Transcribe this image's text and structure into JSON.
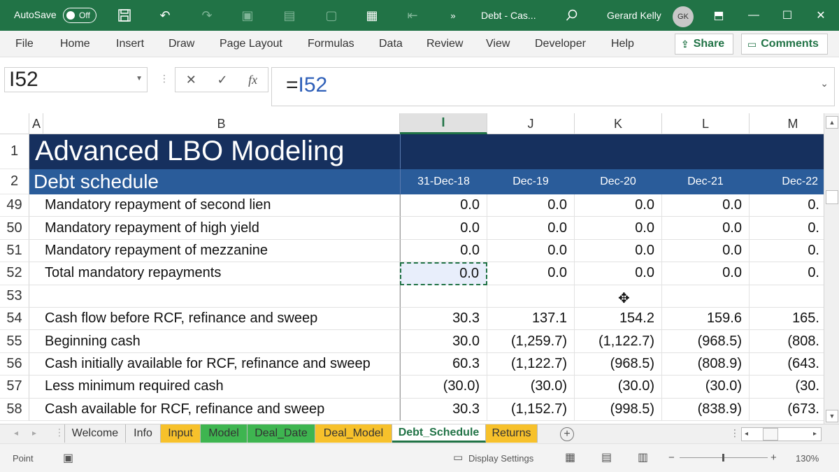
{
  "titlebar": {
    "autosave_label": "AutoSave",
    "autosave_state": "Off",
    "doc_title": "Debt - Cas...",
    "more": "»",
    "user_name": "Gerard Kelly",
    "user_initials": "GK"
  },
  "ribbon": {
    "tabs": [
      "File",
      "Home",
      "Insert",
      "Draw",
      "Page Layout",
      "Formulas",
      "Data",
      "Review",
      "View",
      "Developer",
      "Help"
    ],
    "share_label": "Share",
    "comments_label": "Comments"
  },
  "formula_bar": {
    "name_box": "I52",
    "formula_prefix": "=",
    "formula_ref": "I52",
    "fx": "fx"
  },
  "columns": {
    "A": "A",
    "B": "B",
    "I": "I",
    "J": "J",
    "K": "K",
    "L": "L",
    "M": "M"
  },
  "banner": {
    "title": "Advanced LBO Modeling",
    "subtitle": "Debt schedule",
    "dates": [
      "31-Dec-18",
      "Dec-19",
      "Dec-20",
      "Dec-21",
      "Dec-22"
    ]
  },
  "rows": [
    {
      "num": "49",
      "label": "Mandatory repayment of second lien",
      "vals": [
        "0.0",
        "0.0",
        "0.0",
        "0.0",
        "0."
      ]
    },
    {
      "num": "50",
      "label": "Mandatory repayment of high yield",
      "vals": [
        "0.0",
        "0.0",
        "0.0",
        "0.0",
        "0."
      ]
    },
    {
      "num": "51",
      "label": "Mandatory repayment of mezzanine",
      "vals": [
        "0.0",
        "0.0",
        "0.0",
        "0.0",
        "0."
      ]
    },
    {
      "num": "52",
      "label": "Total mandatory repayments",
      "vals": [
        "0.0",
        "0.0",
        "0.0",
        "0.0",
        "0."
      ]
    },
    {
      "num": "53",
      "label": "",
      "vals": [
        "",
        "",
        "",
        "",
        ""
      ]
    },
    {
      "num": "54",
      "label": "Cash flow before RCF, refinance and sweep",
      "vals": [
        "30.3",
        "137.1",
        "154.2",
        "159.6",
        "165."
      ]
    },
    {
      "num": "55",
      "label": "Beginning cash",
      "vals": [
        "30.0",
        "(1,259.7)",
        "(1,122.7)",
        "(968.5)",
        "(808."
      ]
    },
    {
      "num": "56",
      "label": "Cash initially available for RCF, refinance and sweep",
      "vals": [
        "60.3",
        "(1,122.7)",
        "(968.5)",
        "(808.9)",
        "(643."
      ]
    },
    {
      "num": "57",
      "label": "Less minimum required cash",
      "vals": [
        "(30.0)",
        "(30.0)",
        "(30.0)",
        "(30.0)",
        "(30."
      ]
    },
    {
      "num": "58",
      "label": "Cash available for RCF, refinance and sweep",
      "vals": [
        "30.3",
        "(1,152.7)",
        "(998.5)",
        "(838.9)",
        "(673."
      ]
    }
  ],
  "row_headers": {
    "r1": "1",
    "r2": "2"
  },
  "sheets": [
    "Welcome",
    "Info",
    "Input",
    "Model",
    "Deal_Date",
    "Deal_Model",
    "Debt_Schedule",
    "Returns"
  ],
  "status": {
    "mode": "Point",
    "display_settings": "Display Settings",
    "zoom": "130%",
    "zoom_minus": "−",
    "zoom_plus": "+"
  }
}
